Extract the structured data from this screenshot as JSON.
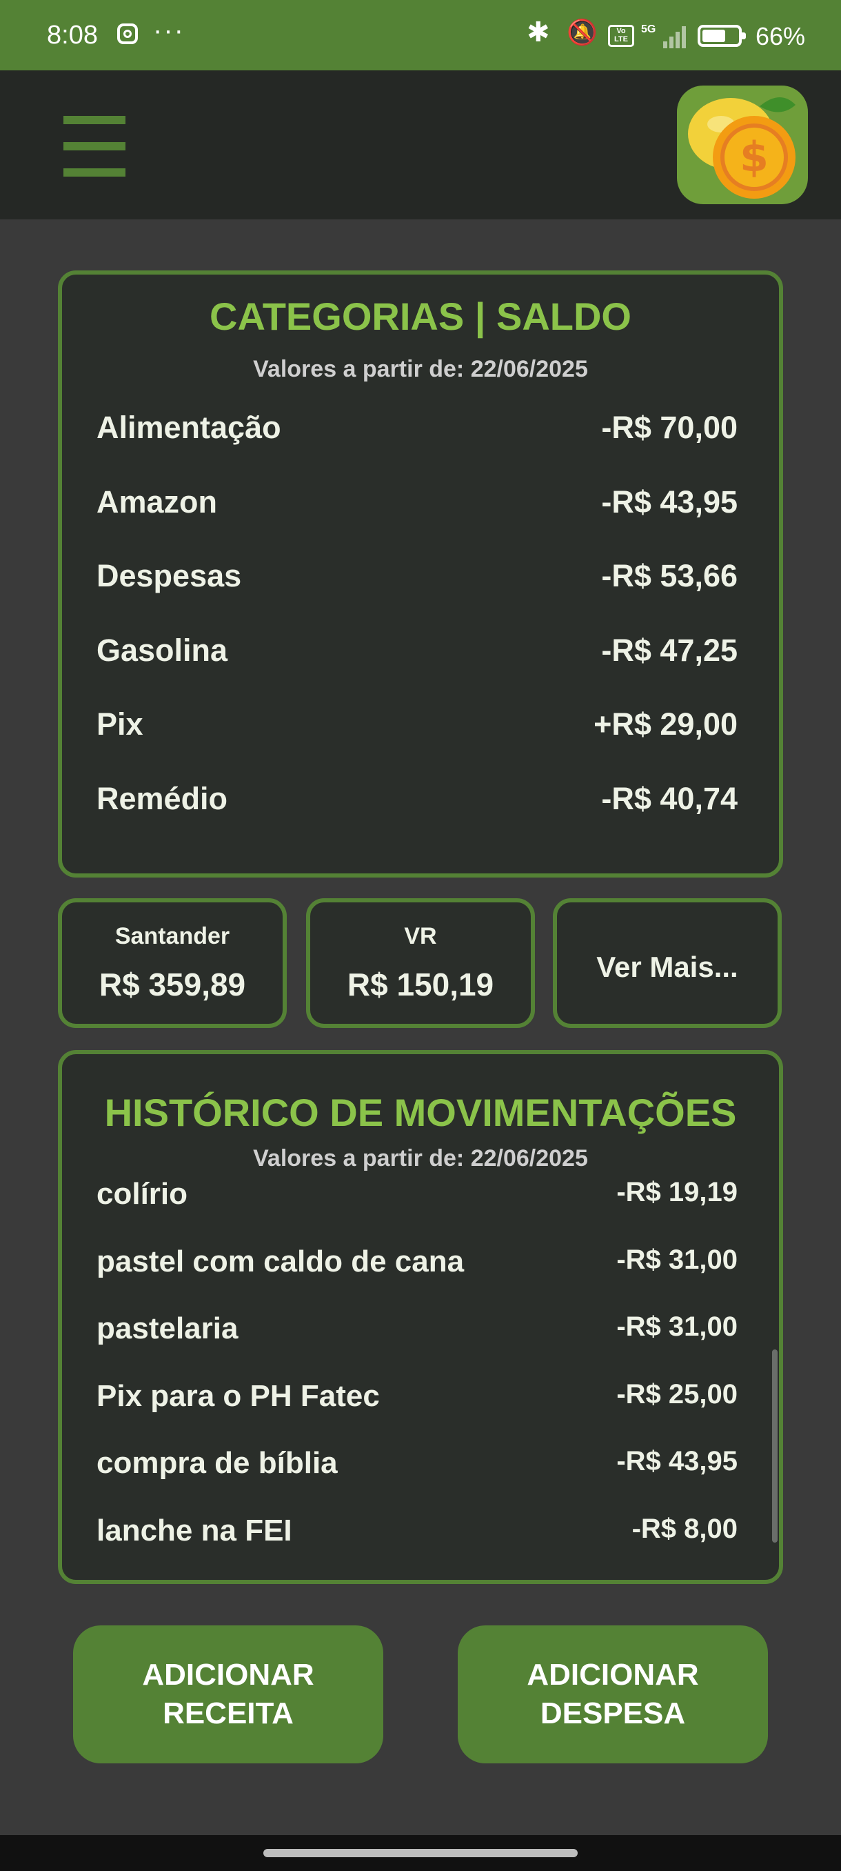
{
  "status_bar": {
    "time": "8:08",
    "more": "···",
    "network": "5G",
    "volte": "Vo LTE",
    "battery": "66%",
    "battery_level": 0.66
  },
  "app_bar": {
    "menu_icon": "hamburger-menu-icon",
    "logo_icon": "lemon-coin-logo-icon"
  },
  "categories": {
    "title": "CATEGORIAS | SALDO",
    "subtitle": "Valores a partir de: 22/06/2025",
    "items": [
      {
        "label": "Alimentação",
        "value": "-R$ 70,00"
      },
      {
        "label": "Amazon",
        "value": "-R$ 43,95"
      },
      {
        "label": "Despesas",
        "value": "-R$ 53,66"
      },
      {
        "label": "Gasolina",
        "value": "-R$ 47,25"
      },
      {
        "label": "Pix",
        "value": "+R$ 29,00"
      },
      {
        "label": "Remédio",
        "value": "-R$ 40,74"
      }
    ]
  },
  "accounts": [
    {
      "name": "Santander",
      "amount": "R$ 359,89"
    },
    {
      "name": "VR",
      "amount": "R$ 150,19"
    }
  ],
  "see_more_label": "Ver Mais...",
  "history": {
    "title": "HISTÓRICO DE MOVIMENTAÇÕES",
    "subtitle": "Valores a partir de: 22/06/2025",
    "items": [
      {
        "label": "colírio",
        "value": "-R$ 19,19"
      },
      {
        "label": "pastel com caldo de cana",
        "value": "-R$ 31,00"
      },
      {
        "label": "pastelaria",
        "value": "-R$ 31,00"
      },
      {
        "label": "Pix para o PH Fatec",
        "value": "-R$ 25,00"
      },
      {
        "label": "compra de bíblia",
        "value": "-R$ 43,95"
      },
      {
        "label": "lanche na FEI",
        "value": "-R$ 8,00"
      }
    ]
  },
  "buttons": {
    "add_income": "ADICIONAR RECEITA",
    "add_expense": "ADICIONAR DESPESA"
  },
  "colors": {
    "accent": "#548235",
    "title_green": "#8bc34a",
    "background": "#3a3a3a",
    "card": "#2a2e2a"
  }
}
